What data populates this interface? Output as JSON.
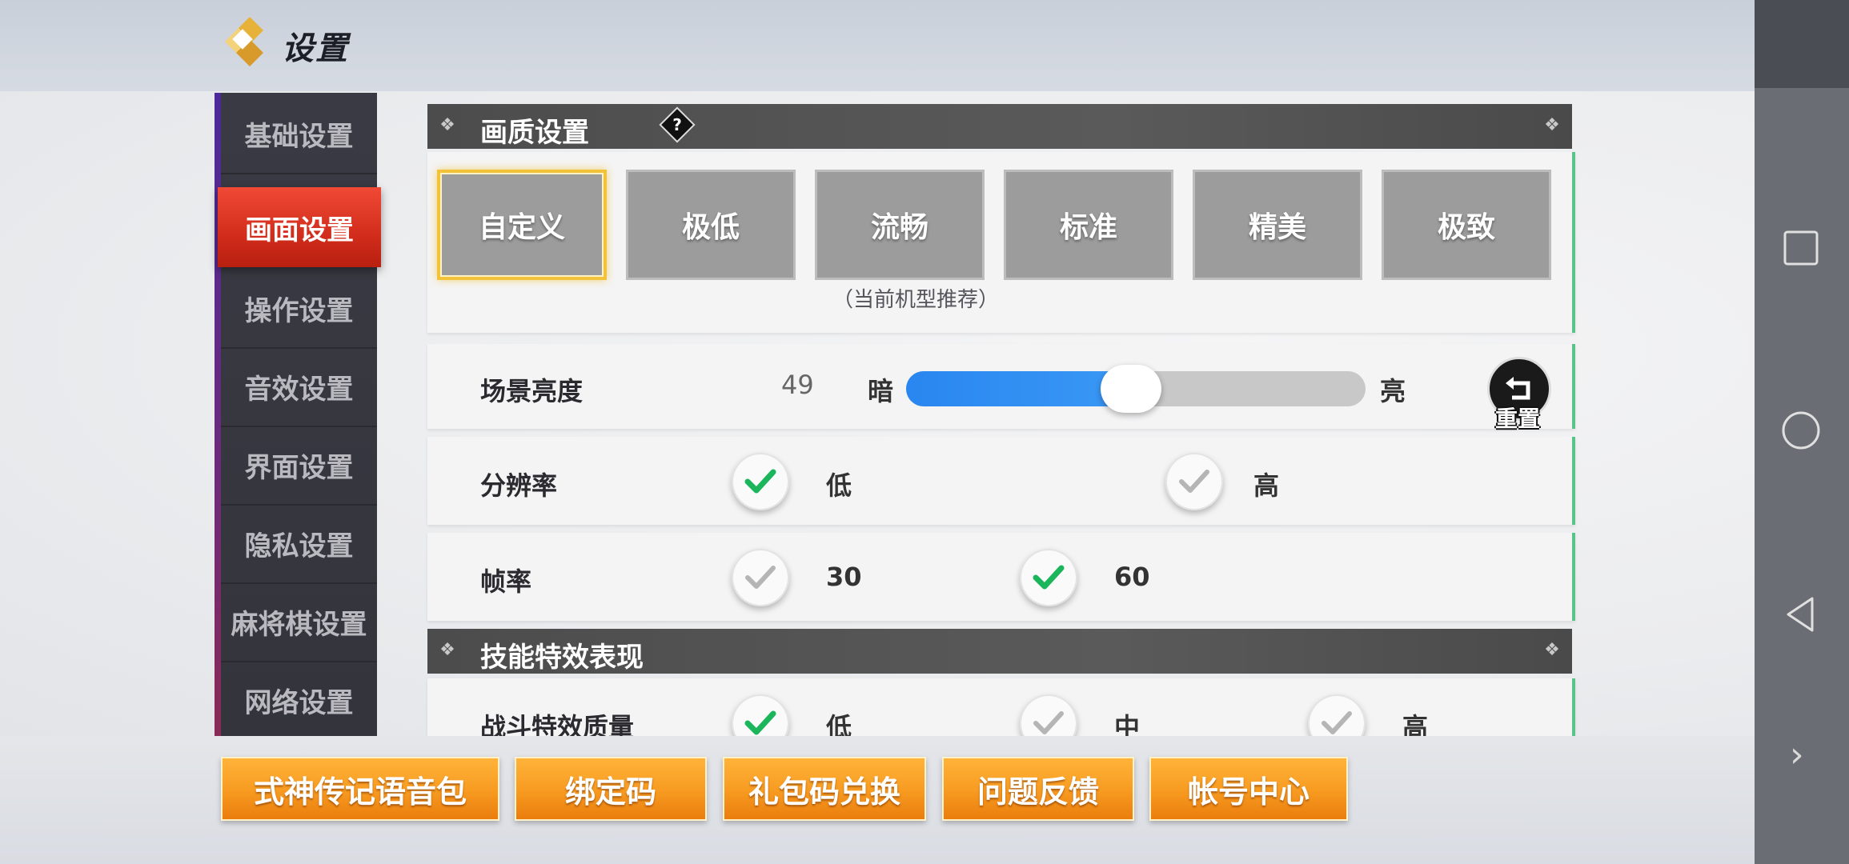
{
  "header": {
    "title": "设置"
  },
  "sidebar": {
    "items": [
      {
        "label": "基础设置"
      },
      {
        "label": "画面设置",
        "active": true
      },
      {
        "label": "操作设置"
      },
      {
        "label": "音效设置"
      },
      {
        "label": "界面设置"
      },
      {
        "label": "隐私设置"
      },
      {
        "label": "麻将棋设置"
      },
      {
        "label": "网络设置"
      }
    ]
  },
  "sections": {
    "quality": {
      "title": "画质设置",
      "help_icon": "?"
    },
    "skill": {
      "title": "技能特效表现"
    }
  },
  "quality_presets": {
    "options": [
      "自定义",
      "极低",
      "流畅",
      "标准",
      "精美",
      "极致"
    ],
    "selected": "自定义",
    "recommended_note": "（当前机型推荐）"
  },
  "brightness": {
    "label": "场景亮度",
    "value": "49",
    "low_label": "暗",
    "high_label": "亮",
    "level_percent": 49,
    "reset_label": "重置"
  },
  "resolution": {
    "label": "分辨率",
    "options": [
      {
        "label": "低",
        "checked": true
      },
      {
        "label": "高",
        "checked": false
      }
    ]
  },
  "framerate": {
    "label": "帧率",
    "options": [
      {
        "label": "30",
        "checked": false
      },
      {
        "label": "60",
        "checked": true
      }
    ]
  },
  "combat_effects": {
    "label": "战斗特效质量",
    "options": [
      {
        "label": "低",
        "checked": true
      },
      {
        "label": "中",
        "checked": false
      },
      {
        "label": "高",
        "checked": false
      }
    ]
  },
  "bottom_buttons": [
    "式神传记语音包",
    "绑定码",
    "礼包码兑换",
    "问题反馈",
    "帐号中心"
  ],
  "colors": {
    "accent_red": "#e03a28",
    "accent_orange": "#f79a20",
    "slider_blue": "#2a86f0",
    "check_green": "#1bb55c"
  }
}
